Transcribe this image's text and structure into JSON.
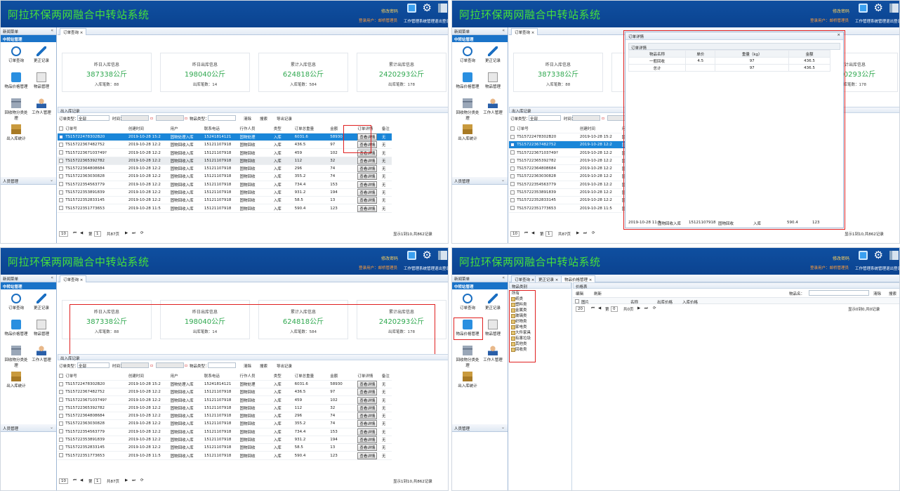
{
  "app": {
    "title": "阿拉环保两网融合中转站系统",
    "change_password": "修改密码",
    "login_user": "登录用户：​邮桥管理员",
    "header_buttons": [
      "工作管理",
      "系统管理",
      "退出登录"
    ],
    "header_icons": [
      "screen-icon",
      "gear-icon",
      "exit-icon"
    ]
  },
  "sidebar": {
    "title": "新闻菜单",
    "section": "中转站管理",
    "items": [
      {
        "label": "订单查询",
        "icon": "search-icon"
      },
      {
        "label": "更正记录",
        "icon": "pen-icon"
      },
      {
        "label": "物品价格管理",
        "icon": "rss-icon"
      },
      {
        "label": "物品管理",
        "icon": "document-icon"
      },
      {
        "label": "回收物分类处理",
        "icon": "server-icon"
      },
      {
        "label": "工作人管理",
        "icon": "person-icon"
      },
      {
        "label": "出入库统计",
        "icon": "boxes-icon"
      }
    ],
    "section2": "人员管理"
  },
  "tabs": {
    "order_query": "订单查询 ×",
    "correction": "更正记录 ×",
    "price_mgmt": "物品价格管理 ×"
  },
  "stats": [
    {
      "title": "昨日入库信息",
      "value": "387338公斤",
      "count": "入库笔数：88"
    },
    {
      "title": "昨日出库信息",
      "value": "198040公斤",
      "count": "出库笔数：14"
    },
    {
      "title": "累计入库信息",
      "value": "624818公斤",
      "count": "入库笔数：584"
    },
    {
      "title": "累计出库信息",
      "value": "2420293公斤",
      "count": "出库笔数：178"
    }
  ],
  "records": {
    "title": "出入库记录",
    "toolbar": {
      "order_type": "订单类型：",
      "order_type_value": "全部",
      "time": "时间：",
      "item_type": "物品类型：",
      "clear": "清除",
      "search": "搜索",
      "export": "导出记录"
    },
    "columns": [
      "订单号",
      "创建时间",
      "用户",
      "联系电话",
      "行作人员",
      "类型",
      "订单总重量",
      "金额",
      "订单详情",
      "备注"
    ],
    "rows": [
      [
        "TS15722478302B20",
        "2019-10-28 15:2",
        "固物处理入库",
        "15241814121",
        "固物处理",
        "入库",
        "6031.6",
        "58930",
        "查看详情",
        "无"
      ],
      [
        "TS15722367482752",
        "2019-10-28 12:2",
        "固物回收入库",
        "15121107918",
        "固物回收",
        "入库",
        "436.5",
        "97",
        "查看详情",
        "无"
      ],
      [
        "TS15722367103749?",
        "2019-10-28 12:2",
        "固物回收入库",
        "15121107918",
        "固物回收",
        "入库",
        "459",
        "102",
        "查看详情",
        "无"
      ],
      [
        "TS15722365392782",
        "2019-10-28 12:2",
        "固物回收入库",
        "15121107918",
        "固物回收",
        "入库",
        "112",
        "32",
        "查看详情",
        "无"
      ],
      [
        "TS15722364808684",
        "2019-10-28 12:2",
        "固物回收入库",
        "15121107918",
        "固物回收",
        "入库",
        "296",
        "74",
        "查看详情",
        "无"
      ],
      [
        "TS15722363030828",
        "2019-10-28 12:2",
        "固物回收入库",
        "15121107918",
        "固物回收",
        "入库",
        "355.2",
        "74",
        "查看详情",
        "无"
      ],
      [
        "TS15722354563779",
        "2019-10-28 12:2",
        "固物回收入库",
        "15121107918",
        "固物回收",
        "入库",
        "734.4",
        "153",
        "查看详情",
        "无"
      ],
      [
        "TS15722353891839",
        "2019-10-28 12:2",
        "固物回收入库",
        "15121107918",
        "固物回收",
        "入库",
        "931.2",
        "194",
        "查看详情",
        "无"
      ],
      [
        "TS15722352833145",
        "2019-10-28 12:2",
        "固物回收入库",
        "15121107918",
        "固物回收",
        "入库",
        "58.5",
        "13",
        "查看详情",
        "无"
      ],
      [
        "TS15722351773653",
        "2019-10-28 11:5",
        "固物回收入库",
        "15121107918",
        "固物回收",
        "入库",
        "590.4",
        "123",
        "查看详情",
        "无"
      ]
    ],
    "pager": {
      "page_size": "10",
      "page_label": "第",
      "page_value": "1",
      "total_pages": "共87页",
      "refresh": "⟳",
      "summary": "显示1到10,共862记录"
    }
  },
  "dialog": {
    "title": "订单详情",
    "close": "×",
    "subtitle": "订单详情",
    "columns": [
      "物品名称",
      "单价",
      "重量（kg）",
      "金额"
    ],
    "rows": [
      [
        "一般回收",
        "4.5",
        "97",
        "436.5"
      ],
      [
        "总计",
        "",
        "97",
        "436.5"
      ]
    ],
    "footer_row": [
      "2019-10-28 11:5",
      "固物回收入库",
      "15121107918",
      "固物回收",
      "入库",
      "590.4",
      "123"
    ]
  },
  "price_page": {
    "tree_root": "所有",
    "tree_title": "物品类别",
    "categories": [
      "纸类",
      "塑料类",
      "金属类",
      "玻璃类",
      "织物类",
      "家电类",
      "大件家具",
      "有害垃圾",
      "其他类",
      "回收类"
    ],
    "panel_title": "价格表",
    "toolbar": {
      "edit": "编辑",
      "refresh": "刷新",
      "item_name": "物品名：",
      "clear": "清除",
      "search": "搜索"
    },
    "columns": [
      "图片",
      "名称",
      "出库价格",
      "入库价格"
    ],
    "pager": {
      "page_size": "20",
      "page_label": "第",
      "page_value": "0",
      "total_pages": "共0页",
      "summary": "显示0到0,共0记录"
    }
  }
}
